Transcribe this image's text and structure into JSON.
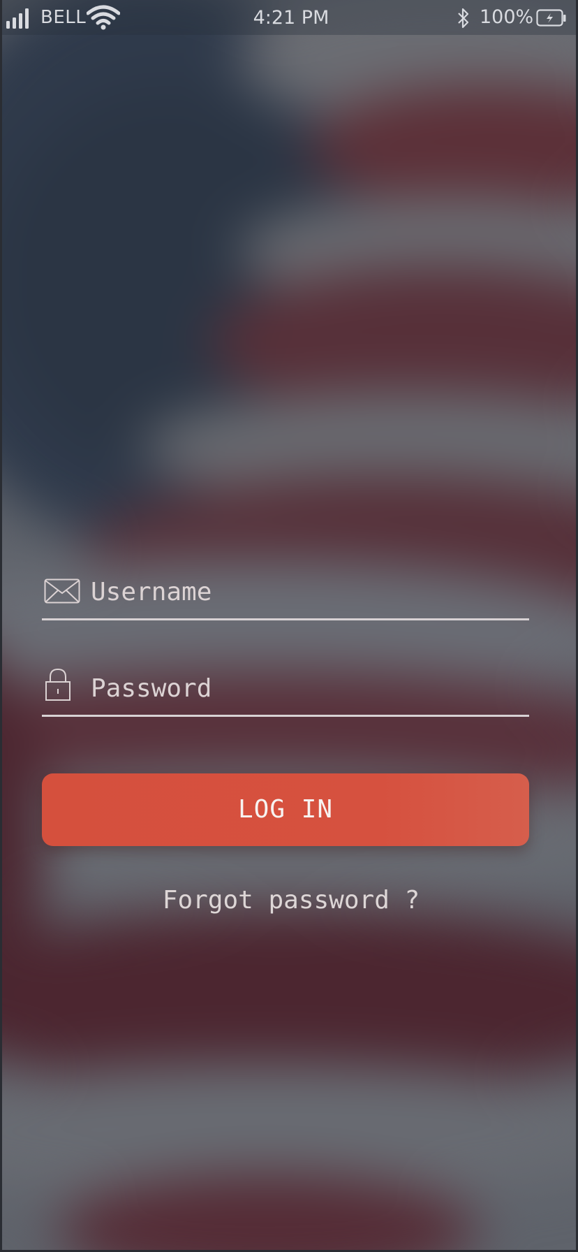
{
  "status_bar": {
    "carrier": "BELL",
    "time": "4:21 PM",
    "battery_percent": "100%",
    "icons": [
      "signal-icon",
      "wifi-icon",
      "bluetooth-icon",
      "battery-charging-icon"
    ]
  },
  "login_form": {
    "username": {
      "placeholder": "Username",
      "value": "",
      "icon": "mail-icon"
    },
    "password": {
      "placeholder": "Password",
      "value": "",
      "icon": "lock-icon"
    },
    "login_button_label": "LOG IN",
    "forgot_password_label": "Forgot password ?"
  },
  "colors": {
    "accent": "#d5503d",
    "background": "#5f636b",
    "text": "#e4dcdc"
  }
}
